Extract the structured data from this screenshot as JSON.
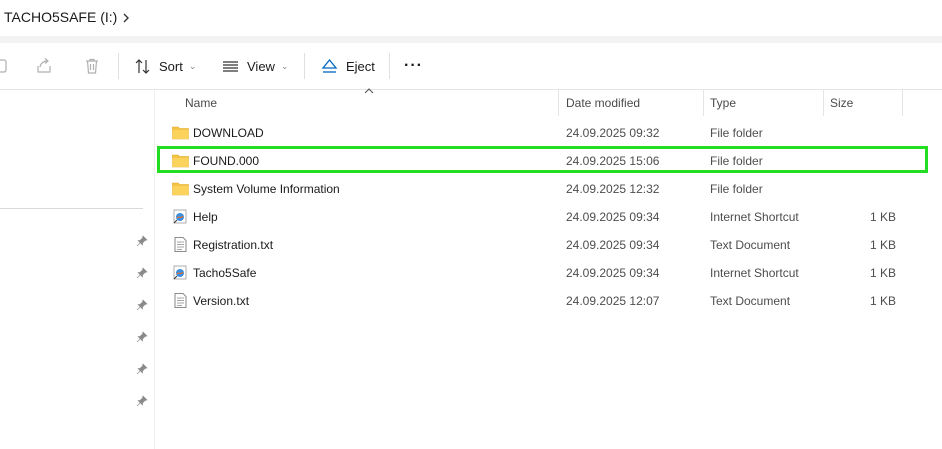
{
  "address": {
    "path": "TACHO5SAFE (I:)"
  },
  "toolbar": {
    "sort_label": "Sort",
    "view_label": "View",
    "eject_label": "Eject",
    "more_label": "···"
  },
  "columns": {
    "name": "Name",
    "date": "Date modified",
    "type": "Type",
    "size": "Size"
  },
  "files": [
    {
      "name": "DOWNLOAD",
      "date": "24.09.2025 09:32",
      "type": "File folder",
      "size": "",
      "icon": "folder-icon"
    },
    {
      "name": "FOUND.000",
      "date": "24.09.2025 15:06",
      "type": "File folder",
      "size": "",
      "icon": "folder-icon"
    },
    {
      "name": "System Volume Information",
      "date": "24.09.2025 12:32",
      "type": "File folder",
      "size": "",
      "icon": "folder-icon"
    },
    {
      "name": "Help",
      "date": "24.09.2025 09:34",
      "type": "Internet Shortcut",
      "size": "1 KB",
      "icon": "internet-shortcut-icon"
    },
    {
      "name": "Registration.txt",
      "date": "24.09.2025 09:34",
      "type": "Text Document",
      "size": "1 KB",
      "icon": "text-document-icon"
    },
    {
      "name": "Tacho5Safe",
      "date": "24.09.2025 09:34",
      "type": "Internet Shortcut",
      "size": "1 KB",
      "icon": "internet-shortcut-icon"
    },
    {
      "name": "Version.txt",
      "date": "24.09.2025 12:07",
      "type": "Text Document",
      "size": "1 KB",
      "icon": "text-document-icon"
    }
  ],
  "colors": {
    "highlight": "#22dd22",
    "folder": "#f6c445",
    "accent": "#0067c0"
  }
}
